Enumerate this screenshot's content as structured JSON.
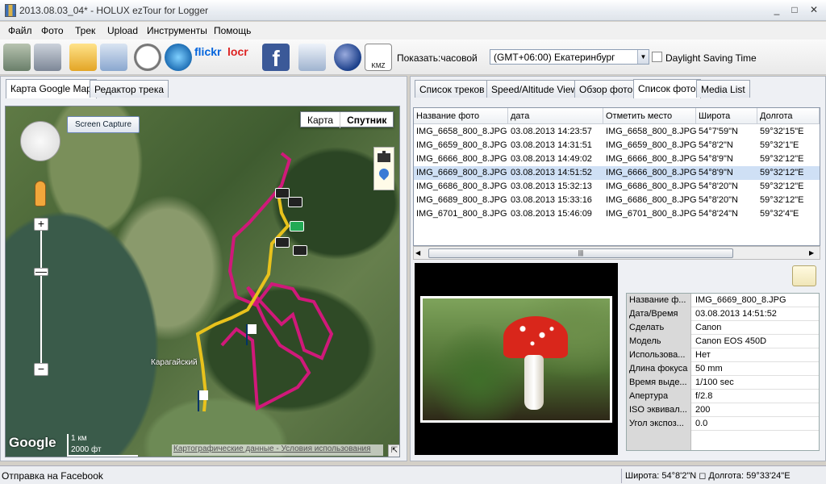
{
  "window": {
    "title": "2013.08.03_04* - HOLUX ezTour for Logger",
    "minimize": "_",
    "maximize": "□",
    "close": "✕"
  },
  "menu": [
    "Файл",
    "Фото",
    "Трек",
    "Upload",
    "Инструменты",
    "Помощь"
  ],
  "toolbar": {
    "timezone_label": "Показать:часовой",
    "timezone_value": "(GMT+06:00) Екатеринбург",
    "dst_label": "Daylight Saving Time",
    "flickr": "flickr",
    "locr": "locr",
    "facebook": "f",
    "kmz": "KMZ"
  },
  "left_tabs": [
    "Карта Google Map",
    "Редактор трека"
  ],
  "map": {
    "type_map": "Карта",
    "type_satellite": "Спутник",
    "screen_capture": "Screen Capture",
    "logo": "Google",
    "scale_km": "1 км",
    "scale_ft": "2000 фт",
    "attribution": "Картографические данные - Условия использования",
    "town": "Карагайский",
    "zoom_in": "+",
    "zoom_out": "−"
  },
  "right_tabs": [
    "Список треков",
    "Speed/Altitude View",
    "Обзор фото",
    "Список фото",
    "Media List"
  ],
  "table": {
    "headers": [
      "Название фото",
      "дата",
      "Отметить место",
      "Широта",
      "Долгота"
    ],
    "rows": [
      [
        "IMG_6658_800_8.JPG",
        "03.08.2013 14:23:57",
        "IMG_6658_800_8.JPG",
        "54°7'59\"N",
        "59°32'15\"E"
      ],
      [
        "IMG_6659_800_8.JPG",
        "03.08.2013 14:31:51",
        "IMG_6659_800_8.JPG",
        "54°8'2\"N",
        "59°32'1\"E"
      ],
      [
        "IMG_6666_800_8.JPG",
        "03.08.2013 14:49:02",
        "IMG_6666_800_8.JPG",
        "54°8'9\"N",
        "59°32'12\"E"
      ],
      [
        "IMG_6669_800_8.JPG",
        "03.08.2013 14:51:52",
        "IMG_6666_800_8.JPG",
        "54°8'9\"N",
        "59°32'12\"E"
      ],
      [
        "IMG_6686_800_8.JPG",
        "03.08.2013 15:32:13",
        "IMG_6686_800_8.JPG",
        "54°8'20\"N",
        "59°32'12\"E"
      ],
      [
        "IMG_6689_800_8.JPG",
        "03.08.2013 15:33:16",
        "IMG_6686_800_8.JPG",
        "54°8'20\"N",
        "59°32'12\"E"
      ],
      [
        "IMG_6701_800_8.JPG",
        "03.08.2013 15:46:09",
        "IMG_6701_800_8.JPG",
        "54°8'24\"N",
        "59°32'4\"E"
      ]
    ]
  },
  "scroll_grip": "|||",
  "properties": [
    [
      "Название ф...",
      "IMG_6669_800_8.JPG"
    ],
    [
      "Дата/Время",
      "03.08.2013 14:51:52"
    ],
    [
      "Сделать",
      "Canon"
    ],
    [
      "Модель",
      "Canon EOS 450D"
    ],
    [
      "Использова...",
      "Нет"
    ],
    [
      "Длина фокуса",
      "50 mm"
    ],
    [
      "Время выде...",
      "1/100 sec"
    ],
    [
      "Апертура",
      "f/2.8"
    ],
    [
      "ISO эквивал...",
      "200"
    ],
    [
      "Угол экспоз...",
      "0.0"
    ]
  ],
  "status": {
    "left": "Отправка на Facebook",
    "right": "Широта: 54°8'2\"N ◻ Долгота: 59°33'24\"E"
  }
}
